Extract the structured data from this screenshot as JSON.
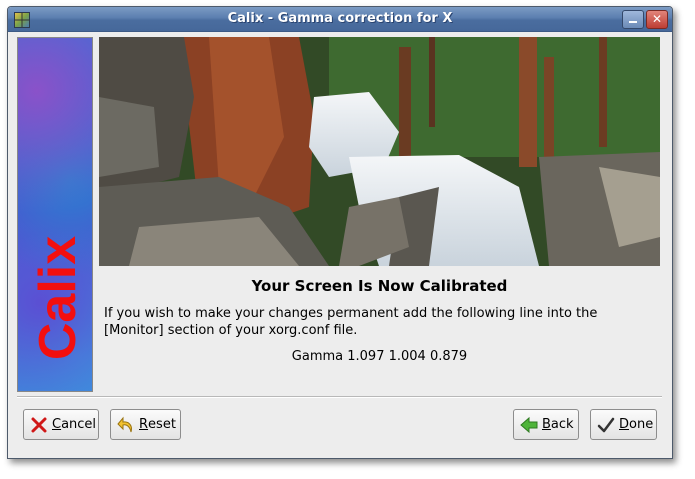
{
  "window": {
    "title": "Calix - Gamma correction for X"
  },
  "sidebar": {
    "logo_text": "Calix",
    "logo_color": "#f20f0f"
  },
  "content": {
    "heading": "Your Screen Is Now Calibrated",
    "message": "If you wish to make your changes permanent add the following line into the [Monitor] section of your xorg.conf file.",
    "gamma_line": "Gamma 1.097 1.004 0.879"
  },
  "buttons": {
    "cancel": {
      "mnemonic": "C",
      "rest": "ancel",
      "icon": "cancel-x-icon"
    },
    "reset": {
      "mnemonic": "R",
      "rest": "eset",
      "icon": "undo-arrow-icon"
    },
    "back": {
      "mnemonic": "B",
      "rest": "ack",
      "icon": "back-arrow-icon"
    },
    "done": {
      "mnemonic": "D",
      "rest": "one",
      "icon": "checkmark-icon"
    }
  },
  "colors": {
    "titlebar": "#5b7eaf",
    "window_bg": "#ededed",
    "close_button": "#bd3e34"
  }
}
